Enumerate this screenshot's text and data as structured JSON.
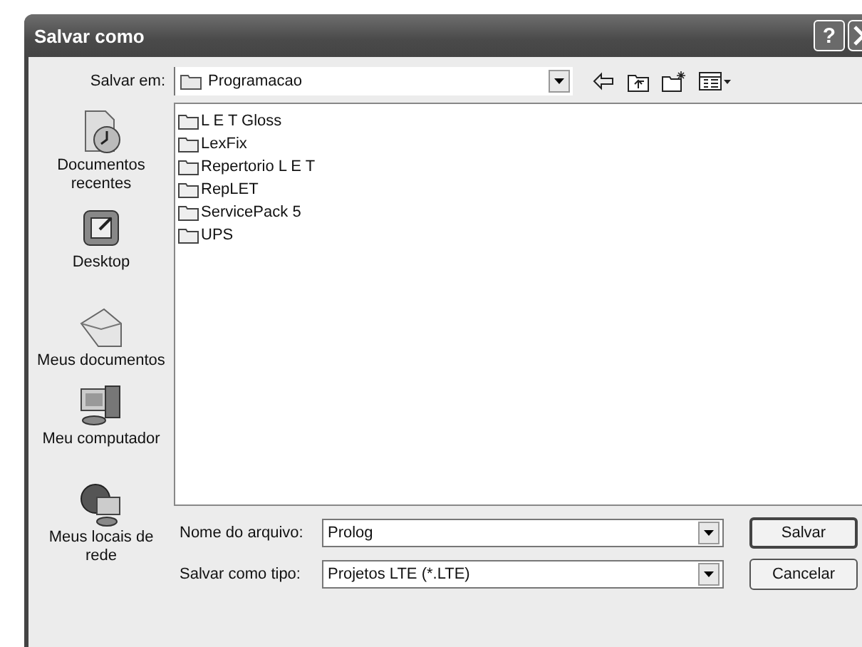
{
  "window": {
    "title": "Salvar como",
    "help_button": "?"
  },
  "location": {
    "label": "Salvar em:",
    "value": "Programacao"
  },
  "places": [
    {
      "kind": "recent",
      "label": "Documentos recentes"
    },
    {
      "kind": "desktop",
      "label": "Desktop"
    },
    {
      "kind": "documents",
      "label": "Meus documentos"
    },
    {
      "kind": "computer",
      "label": "Meu computador"
    },
    {
      "kind": "network",
      "label": "Meus locais de rede"
    }
  ],
  "files": [
    {
      "name": "L E T Gloss"
    },
    {
      "name": "LexFix"
    },
    {
      "name": "Repertorio L E T"
    },
    {
      "name": "RepLET"
    },
    {
      "name": "ServicePack 5"
    },
    {
      "name": "UPS"
    }
  ],
  "file_name": {
    "label": "Nome do arquivo:",
    "value": "Prolog"
  },
  "file_type": {
    "label": "Salvar como tipo:",
    "value": "Projetos LTE (*.LTE)"
  },
  "buttons": [
    "Salvar",
    "Cancelar"
  ]
}
